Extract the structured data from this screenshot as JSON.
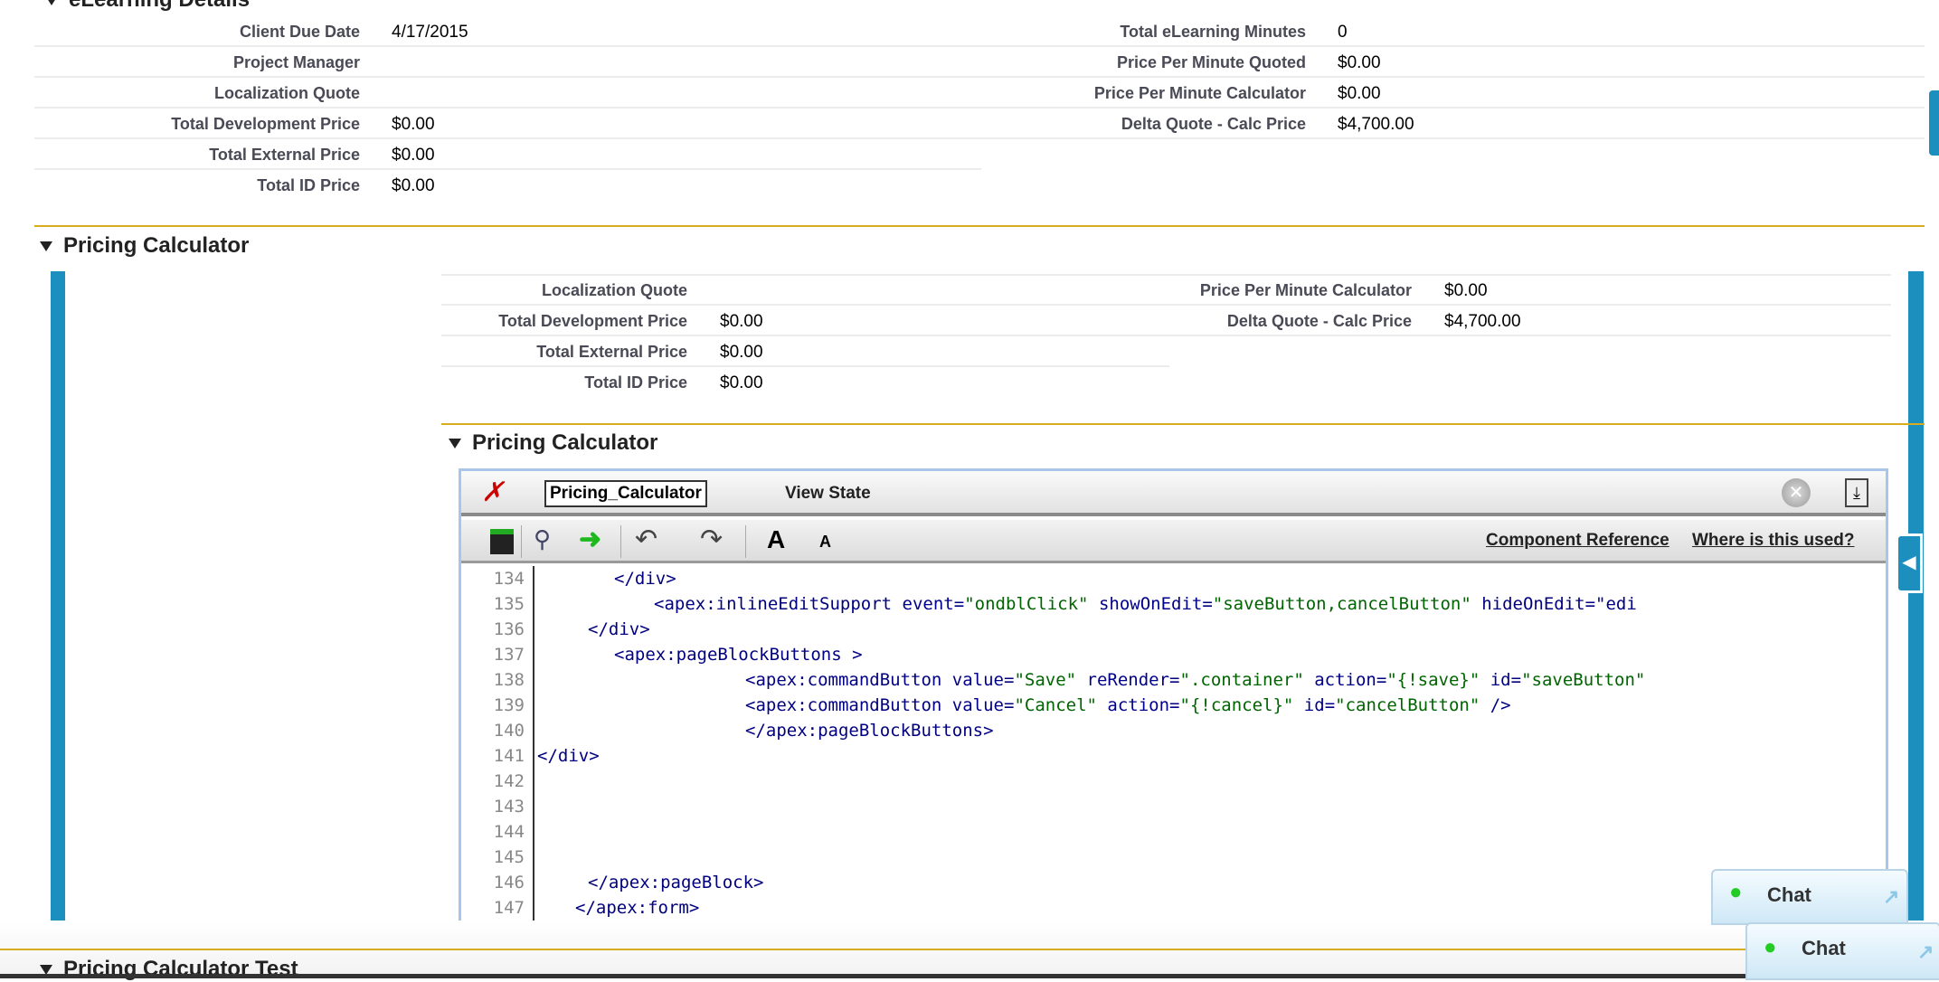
{
  "elearning_section": {
    "title": "eLearning Details",
    "left_fields": [
      {
        "label": "Client Due Date",
        "value": "4/17/2015"
      },
      {
        "label": "Project Manager",
        "value": ""
      },
      {
        "label": "Localization Quote",
        "value": ""
      },
      {
        "label": "Total Development Price",
        "value": "$0.00"
      },
      {
        "label": "Total External Price",
        "value": "$0.00"
      },
      {
        "label": "Total ID Price",
        "value": "$0.00"
      }
    ],
    "right_fields": [
      {
        "label": "Total eLearning Minutes",
        "value": "0"
      },
      {
        "label": "Price Per Minute Quoted",
        "value": "$0.00"
      },
      {
        "label": "Price Per Minute Calculator",
        "value": "$0.00"
      },
      {
        "label": "Delta Quote - Calc Price",
        "value": "$4,700.00"
      }
    ]
  },
  "pricing_section": {
    "title": "Pricing Calculator",
    "left_fields": [
      {
        "label": "Localization Quote",
        "value": ""
      },
      {
        "label": "Total Development Price",
        "value": "$0.00"
      },
      {
        "label": "Total External Price",
        "value": "$0.00"
      },
      {
        "label": "Total ID Price",
        "value": "$0.00"
      }
    ],
    "right_fields": [
      {
        "label": "Price Per Minute Calculator",
        "value": "$0.00"
      },
      {
        "label": "Delta Quote - Calc Price",
        "value": "$4,700.00"
      }
    ],
    "inner_title": "Pricing Calculator"
  },
  "editor": {
    "tab_active": "Pricing_Calculator",
    "tab_view_state": "View State",
    "links": {
      "component_reference": "Component Reference",
      "where_used": "Where is this used?"
    },
    "font_large": "A",
    "font_small": "A",
    "lines": [
      {
        "n": "134",
        "text": "</div>"
      },
      {
        "n": "135",
        "text": "<apex:inlineEditSupport event=\"ondblClick\" showOnEdit=\"saveButton,cancelButton\" hideOnEdit=\"edi"
      },
      {
        "n": "136",
        "text": "</div>"
      },
      {
        "n": "137",
        "text": "<apex:pageBlockButtons >"
      },
      {
        "n": "138",
        "text": "<apex:commandButton value=\"Save\" reRender=\".container\" action=\"{!save}\" id=\"saveButton\""
      },
      {
        "n": "139",
        "text": "<apex:commandButton value=\"Cancel\" action=\"{!cancel}\" id=\"cancelButton\" />"
      },
      {
        "n": "140",
        "text": "</apex:pageBlockButtons>"
      },
      {
        "n": "141",
        "text": "</div>"
      },
      {
        "n": "142",
        "text": ""
      },
      {
        "n": "143",
        "text": ""
      },
      {
        "n": "144",
        "text": ""
      },
      {
        "n": "145",
        "text": ""
      },
      {
        "n": "146",
        "text": "</apex:pageBlock>"
      },
      {
        "n": "147",
        "text": "</apex:form>"
      }
    ]
  },
  "next_section": {
    "title": "Pricing Calculator Test"
  },
  "chat": {
    "label1": "Chat",
    "label2": "Chat"
  },
  "colors": {
    "accent_gold": "#d9ac1f",
    "side_bar_blue": "#1d8fbf",
    "code_string": "#006400",
    "code_tag": "#000080"
  }
}
